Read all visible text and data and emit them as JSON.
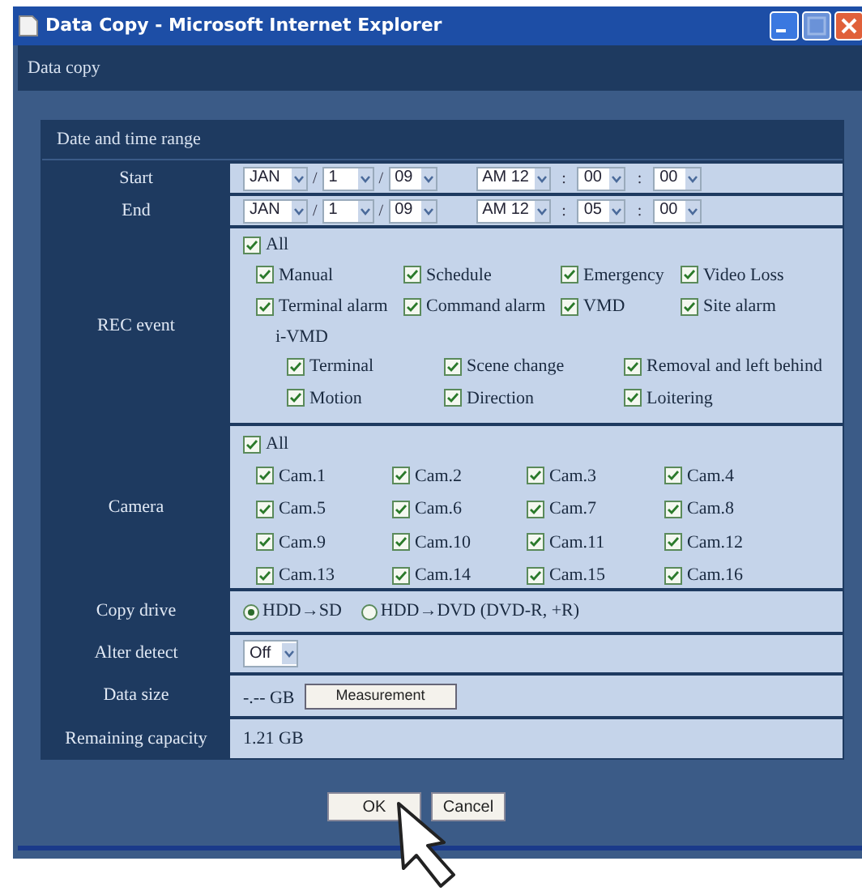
{
  "window": {
    "title": "Data Copy - Microsoft Internet Explorer",
    "maximize_disabled": true
  },
  "page_title": "Data copy",
  "section_title": "Date and time range",
  "date_rows": [
    {
      "label": "Start",
      "month": "JAN",
      "sep1": "/",
      "day": "1",
      "sep2": "/",
      "year": "09",
      "hour": "AM 12",
      "sep3": ":",
      "minute": "00",
      "sep4": ":",
      "second": "00"
    },
    {
      "label": "End",
      "month": "JAN",
      "sep1": "/",
      "day": "1",
      "sep2": "/",
      "year": "09",
      "hour": "AM 12",
      "sep3": ":",
      "minute": "05",
      "sep4": ":",
      "second": "00"
    }
  ],
  "rec_event": {
    "label": "REC event",
    "all": {
      "label": "All",
      "checked": true
    },
    "items": [
      {
        "label": "Manual",
        "checked": true
      },
      {
        "label": "Schedule",
        "checked": true
      },
      {
        "label": "Emergency",
        "checked": true
      },
      {
        "label": "Video Loss",
        "checked": true
      },
      {
        "label": "Terminal alarm",
        "checked": true
      },
      {
        "label": "Command alarm",
        "checked": true
      },
      {
        "label": "VMD",
        "checked": true
      },
      {
        "label": "Site alarm",
        "checked": true
      }
    ],
    "ivmd_label": "i-VMD",
    "ivmd_items": [
      {
        "label": "Terminal",
        "checked": true
      },
      {
        "label": "Scene change",
        "checked": true
      },
      {
        "label": "Removal and left behind",
        "checked": true
      },
      {
        "label": "Motion",
        "checked": true
      },
      {
        "label": "Direction",
        "checked": true
      },
      {
        "label": "Loitering",
        "checked": true
      }
    ]
  },
  "camera": {
    "label": "Camera",
    "all": {
      "label": "All",
      "checked": true
    },
    "items": [
      {
        "label": "Cam.1",
        "checked": true
      },
      {
        "label": "Cam.2",
        "checked": true
      },
      {
        "label": "Cam.3",
        "checked": true
      },
      {
        "label": "Cam.4",
        "checked": true
      },
      {
        "label": "Cam.5",
        "checked": true
      },
      {
        "label": "Cam.6",
        "checked": true
      },
      {
        "label": "Cam.7",
        "checked": true
      },
      {
        "label": "Cam.8",
        "checked": true
      },
      {
        "label": "Cam.9",
        "checked": true
      },
      {
        "label": "Cam.10",
        "checked": true
      },
      {
        "label": "Cam.11",
        "checked": true
      },
      {
        "label": "Cam.12",
        "checked": true
      },
      {
        "label": "Cam.13",
        "checked": true
      },
      {
        "label": "Cam.14",
        "checked": true
      },
      {
        "label": "Cam.15",
        "checked": true
      },
      {
        "label": "Cam.16",
        "checked": true
      }
    ]
  },
  "copy_drive": {
    "label": "Copy drive",
    "options": [
      {
        "label": "HDD→SD",
        "selected": true
      },
      {
        "label": "HDD→DVD (DVD-R, +R)",
        "selected": false
      }
    ]
  },
  "alter_detect": {
    "label": "Alter detect",
    "value": "Off"
  },
  "data_size": {
    "label": "Data size",
    "value": "-.-- GB",
    "button": "Measurement"
  },
  "remaining": {
    "label": "Remaining capacity",
    "value": "1.21 GB"
  },
  "buttons": [
    "OK",
    "Cancel"
  ]
}
